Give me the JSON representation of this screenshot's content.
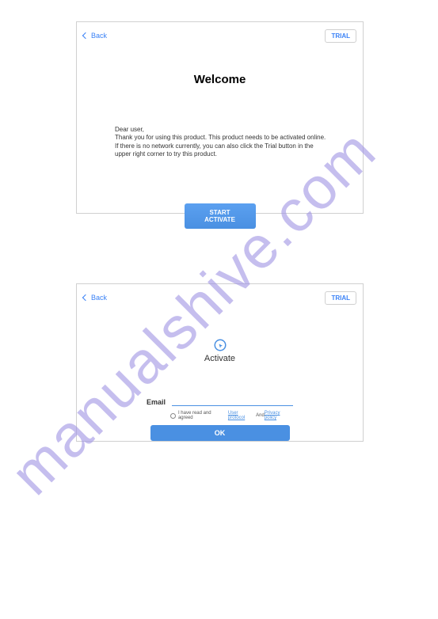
{
  "watermark": "manualshive.com",
  "panel1": {
    "back": "Back",
    "trial": "TRIAL",
    "title": "Welcome",
    "greeting": "Dear user,",
    "line1": "Thank you for using this product. This product needs to be activated online.",
    "line2": "If there is no network currently, you can also click the Trial button in the upper right corner to try this product.",
    "startButton": "START ACTIVATE"
  },
  "panel2": {
    "back": "Back",
    "trial": "TRIAL",
    "title": "Activate",
    "emailLabel": "Email",
    "agreeText": "I have read and agreed",
    "userProtocol": "User protocol",
    "and": " And ",
    "privacyPolicy": "Privacy policy",
    "okButton": "OK"
  }
}
